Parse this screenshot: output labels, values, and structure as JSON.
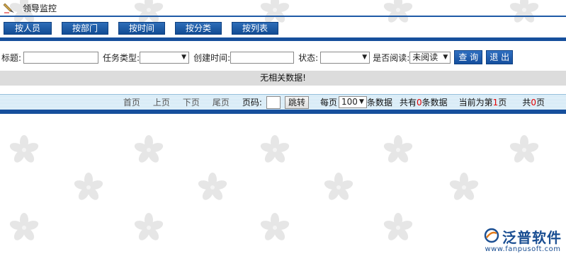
{
  "title": "领导监控",
  "tabs": [
    "按人员",
    "按部门",
    "按时间",
    "按分类",
    "按列表"
  ],
  "filter": {
    "title_label": "标题:",
    "title_value": "",
    "type_label": "任务类型:",
    "type_value": "",
    "created_label": "创建时间:",
    "created_value": "",
    "status_label": "状态:",
    "status_value": "",
    "read_label": "是否阅读:",
    "read_value": "未阅读",
    "search_button": "查 询",
    "exit_button": "退 出"
  },
  "no_data_message": "无相关数据!",
  "pager": {
    "first": "首页",
    "prev": "上页",
    "next": "下页",
    "last": "尾页",
    "page_label": "页码:",
    "page_value": "",
    "jump_button": "跳转",
    "per_page_prefix": "每页",
    "per_page_value": "100",
    "per_page_suffix": "条数据",
    "total_prefix": "共有",
    "total_count": "0",
    "total_suffix": "条数据",
    "current_prefix": "当前为第",
    "current_page": "1",
    "current_suffix": "页",
    "pages_prefix": "共",
    "pages_count": "0",
    "pages_suffix": "页"
  },
  "watermark": {
    "brand": "泛普软件",
    "url": "www.fanpusoft.com"
  },
  "colors": {
    "accent_blue": "#164f9c",
    "nodata_gray": "#dcdcdc",
    "pager_light_blue": "#cfe6f4",
    "highlight_red": "#e00000"
  },
  "icons": [
    "pen-icon",
    "dropdown-arrow-icon",
    "fanpu-logo-icon",
    "sakura-background-pattern"
  ]
}
